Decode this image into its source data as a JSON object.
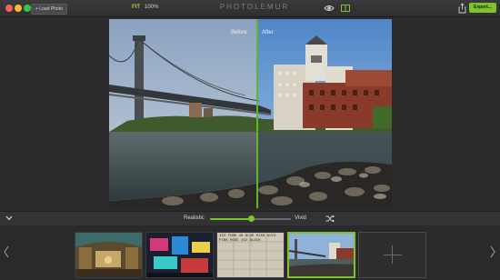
{
  "toolbar": {
    "load_label": "+ Load Photo",
    "fit_label": "FIT",
    "zoom_label": "100%",
    "app_title": "PHOTOLEMUR",
    "export_label": "Export..."
  },
  "compare": {
    "before_label": "Before",
    "after_label": "After"
  },
  "adjust": {
    "min_label": "Realistic",
    "max_label": "Vivid",
    "level": 0.5
  },
  "colors": {
    "accent": "#7ec32a",
    "background": "#2b2b2d"
  },
  "icons": [
    "eye-icon",
    "compare-icon",
    "share-icon",
    "chevron-down-icon",
    "shuffle-icon",
    "chevron-left-icon",
    "chevron-right-icon",
    "plus-icon"
  ],
  "filmstrip": {
    "thumbs": [
      {
        "label": "Grand Central interior",
        "selected": false
      },
      {
        "label": "Neon street signs",
        "selected": false
      },
      {
        "label": "Departure board",
        "selected": false
      },
      {
        "label": "Bridge and waterfront",
        "selected": true
      }
    ],
    "board_text": "153 FUNK 49 BLUE RIEN AVIS PINK ROSE 152 BLACK"
  }
}
